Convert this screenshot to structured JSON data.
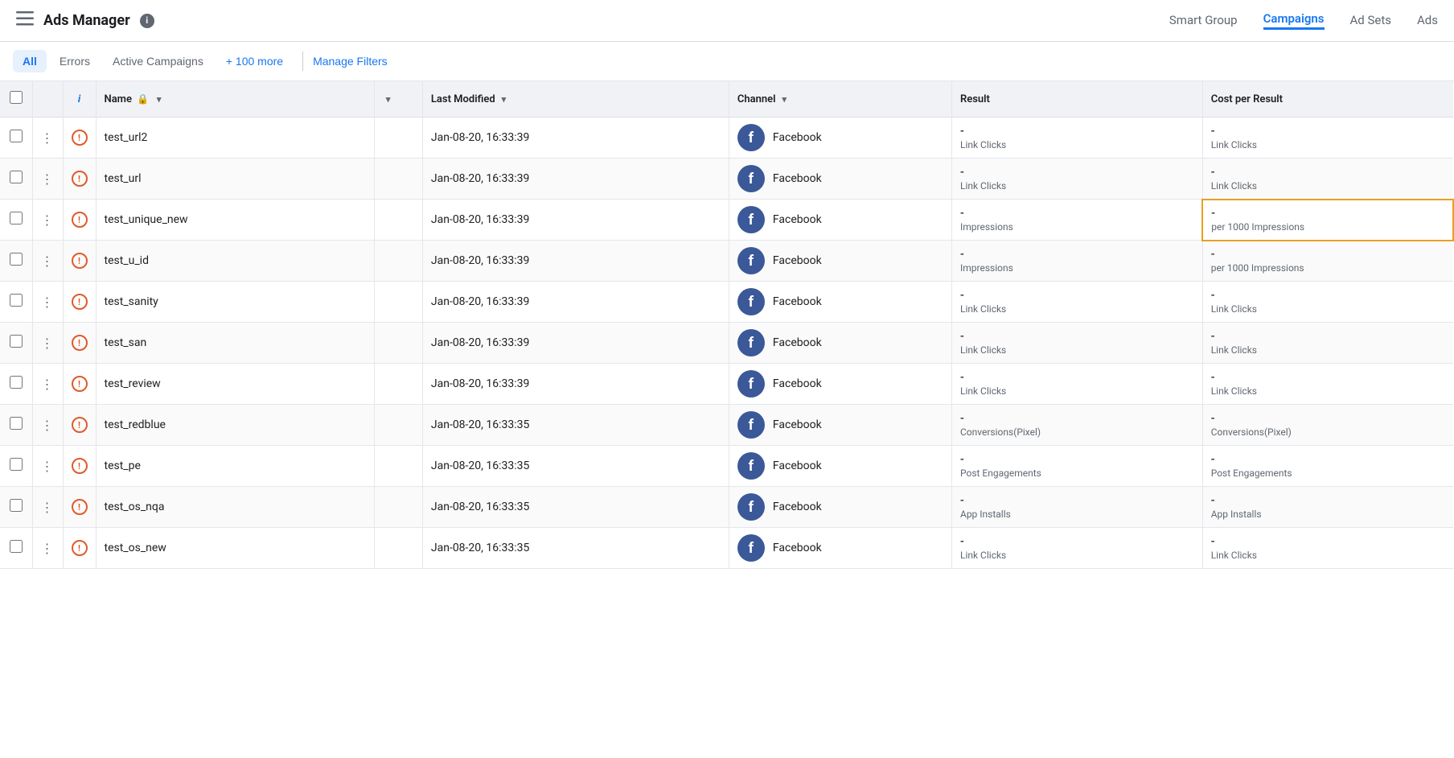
{
  "header": {
    "title": "Ads Manager",
    "info_label": "i",
    "nav": [
      {
        "id": "smart-group",
        "label": "Smart Group",
        "active": false
      },
      {
        "id": "campaigns",
        "label": "Campaigns",
        "active": true
      },
      {
        "id": "ad-sets",
        "label": "Ad Sets",
        "active": false
      },
      {
        "id": "ads",
        "label": "Ads",
        "active": false
      }
    ]
  },
  "filters": {
    "buttons": [
      {
        "id": "all",
        "label": "All",
        "active": true
      },
      {
        "id": "errors",
        "label": "Errors",
        "active": false
      },
      {
        "id": "active-campaigns",
        "label": "Active Campaigns",
        "active": false
      },
      {
        "id": "more",
        "label": "+ 100 more",
        "active": false
      }
    ],
    "manage_label": "Manage Filters"
  },
  "table": {
    "columns": [
      {
        "id": "check",
        "label": ""
      },
      {
        "id": "dots",
        "label": ""
      },
      {
        "id": "info",
        "label": "i"
      },
      {
        "id": "name",
        "label": "Name",
        "has_lock": true,
        "sortable": true
      },
      {
        "id": "col5",
        "label": "",
        "sortable": true
      },
      {
        "id": "last-modified",
        "label": "Last Modified",
        "sortable": true
      },
      {
        "id": "channel",
        "label": "Channel",
        "sortable": true
      },
      {
        "id": "result",
        "label": "Result"
      },
      {
        "id": "cost-per-result",
        "label": "Cost per Result"
      }
    ],
    "rows": [
      {
        "id": 1,
        "name": "test_url2",
        "last_modified": "Jan-08-20, 16:33:39",
        "channel": "Facebook",
        "result_main": "-",
        "result_sub": "Link Clicks",
        "cost_main": "-",
        "cost_sub": "Link Clicks",
        "highlighted": false
      },
      {
        "id": 2,
        "name": "test_url",
        "last_modified": "Jan-08-20, 16:33:39",
        "channel": "Facebook",
        "result_main": "-",
        "result_sub": "Link Clicks",
        "cost_main": "-",
        "cost_sub": "Link Clicks",
        "highlighted": false
      },
      {
        "id": 3,
        "name": "test_unique_new",
        "last_modified": "Jan-08-20, 16:33:39",
        "channel": "Facebook",
        "result_main": "-",
        "result_sub": "Impressions",
        "cost_main": "-",
        "cost_sub": "per 1000 Impressions",
        "highlighted": true
      },
      {
        "id": 4,
        "name": "test_u_id",
        "last_modified": "Jan-08-20, 16:33:39",
        "channel": "Facebook",
        "result_main": "-",
        "result_sub": "Impressions",
        "cost_main": "-",
        "cost_sub": "per 1000 Impressions",
        "highlighted": false
      },
      {
        "id": 5,
        "name": "test_sanity",
        "last_modified": "Jan-08-20, 16:33:39",
        "channel": "Facebook",
        "result_main": "-",
        "result_sub": "Link Clicks",
        "cost_main": "-",
        "cost_sub": "Link Clicks",
        "highlighted": false
      },
      {
        "id": 6,
        "name": "test_san",
        "last_modified": "Jan-08-20, 16:33:39",
        "channel": "Facebook",
        "result_main": "-",
        "result_sub": "Link Clicks",
        "cost_main": "-",
        "cost_sub": "Link Clicks",
        "highlighted": false
      },
      {
        "id": 7,
        "name": "test_review",
        "last_modified": "Jan-08-20, 16:33:39",
        "channel": "Facebook",
        "result_main": "-",
        "result_sub": "Link Clicks",
        "cost_main": "-",
        "cost_sub": "Link Clicks",
        "highlighted": false
      },
      {
        "id": 8,
        "name": "test_redblue",
        "last_modified": "Jan-08-20, 16:33:35",
        "channel": "Facebook",
        "result_main": "-",
        "result_sub": "Conversions(Pixel)",
        "cost_main": "-",
        "cost_sub": "Conversions(Pixel)",
        "highlighted": false
      },
      {
        "id": 9,
        "name": "test_pe",
        "last_modified": "Jan-08-20, 16:33:35",
        "channel": "Facebook",
        "result_main": "-",
        "result_sub": "Post Engagements",
        "cost_main": "-",
        "cost_sub": "Post Engagements",
        "highlighted": false
      },
      {
        "id": 10,
        "name": "test_os_nqa",
        "last_modified": "Jan-08-20, 16:33:35",
        "channel": "Facebook",
        "result_main": "-",
        "result_sub": "App Installs",
        "cost_main": "-",
        "cost_sub": "App Installs",
        "highlighted": false
      },
      {
        "id": 11,
        "name": "test_os_new",
        "last_modified": "Jan-08-20, 16:33:35",
        "channel": "Facebook",
        "result_main": "-",
        "result_sub": "Link Clicks",
        "cost_main": "-",
        "cost_sub": "Link Clicks",
        "highlighted": false
      }
    ]
  }
}
